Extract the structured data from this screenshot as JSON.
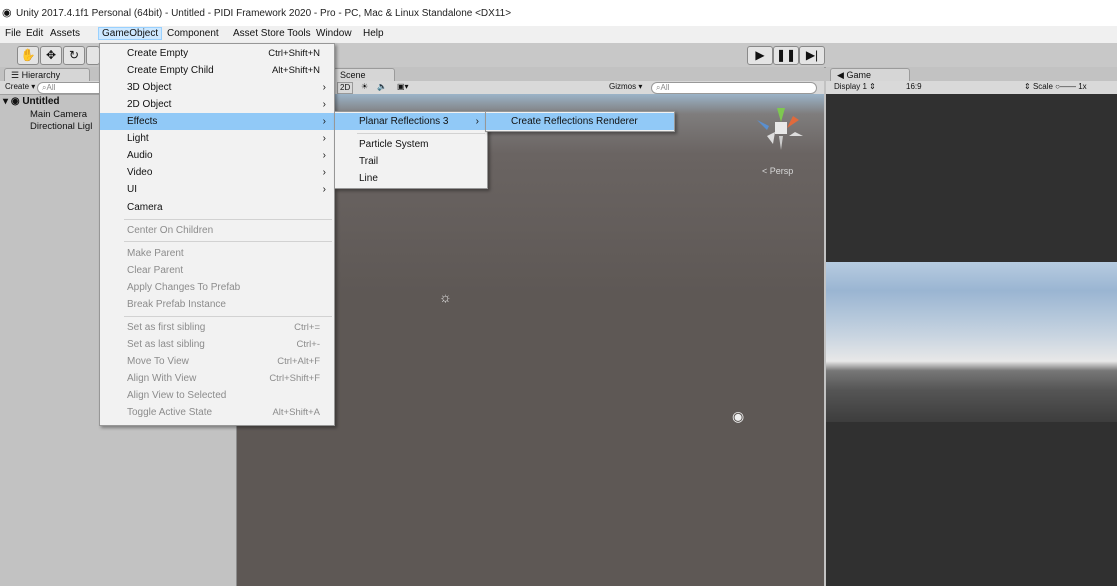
{
  "window": {
    "title": "Unity 2017.4.1f1 Personal (64bit) - Untitled - PIDI Framework 2020 - Pro - PC, Mac & Linux Standalone <DX11>"
  },
  "menubar": [
    "File",
    "Edit",
    "Assets",
    "GameObject",
    "Component",
    "Asset Store Tools",
    "Window",
    "Help"
  ],
  "hierarchy": {
    "tab": "Hierarchy",
    "create_label": "Create",
    "search_placeholder": "All",
    "scene_name": "Untitled",
    "items": [
      "Main Camera",
      "Directional Ligl"
    ]
  },
  "scene": {
    "tab": "Scene",
    "mode_2d": "2D",
    "gizmos_label": "Gizmos",
    "search_placeholder": "All",
    "persp_label": "Persp"
  },
  "game": {
    "tab": "Game",
    "display": "Display 1",
    "aspect": "16:9",
    "scale_label": "Scale",
    "scale_value": "1x"
  },
  "gameobject_menu": [
    {
      "label": "Create Empty",
      "shortcut": "Ctrl+Shift+N"
    },
    {
      "label": "Create Empty Child",
      "shortcut": "Alt+Shift+N"
    },
    {
      "label": "3D Object",
      "submenu": true
    },
    {
      "label": "2D Object",
      "submenu": true
    },
    {
      "label": "Effects",
      "submenu": true,
      "highlighted": true
    },
    {
      "label": "Light",
      "submenu": true
    },
    {
      "label": "Audio",
      "submenu": true
    },
    {
      "label": "Video",
      "submenu": true
    },
    {
      "label": "UI",
      "submenu": true
    },
    {
      "label": "Camera"
    },
    {
      "label": "Center On Children",
      "disabled": true
    },
    {
      "label": "Make Parent",
      "disabled": true
    },
    {
      "label": "Clear Parent",
      "disabled": true
    },
    {
      "label": "Apply Changes To Prefab",
      "disabled": true
    },
    {
      "label": "Break Prefab Instance",
      "disabled": true
    },
    {
      "label": "Set as first sibling",
      "shortcut": "Ctrl+=",
      "disabled": true
    },
    {
      "label": "Set as last sibling",
      "shortcut": "Ctrl+-",
      "disabled": true
    },
    {
      "label": "Move To View",
      "shortcut": "Ctrl+Alt+F",
      "disabled": true
    },
    {
      "label": "Align With View",
      "shortcut": "Ctrl+Shift+F",
      "disabled": true
    },
    {
      "label": "Align View to Selected",
      "disabled": true
    },
    {
      "label": "Toggle Active State",
      "shortcut": "Alt+Shift+A",
      "disabled": true
    }
  ],
  "effects_menu": [
    {
      "label": "Planar Reflections 3",
      "submenu": true,
      "highlighted": true
    },
    {
      "label": "Particle System"
    },
    {
      "label": "Trail"
    },
    {
      "label": "Line"
    }
  ],
  "planar_menu": [
    {
      "label": "Create Reflections Renderer",
      "highlighted": true
    }
  ],
  "colors": {
    "menu_highlight": "#91c9f7",
    "menubar_active": "#cde8ff"
  }
}
